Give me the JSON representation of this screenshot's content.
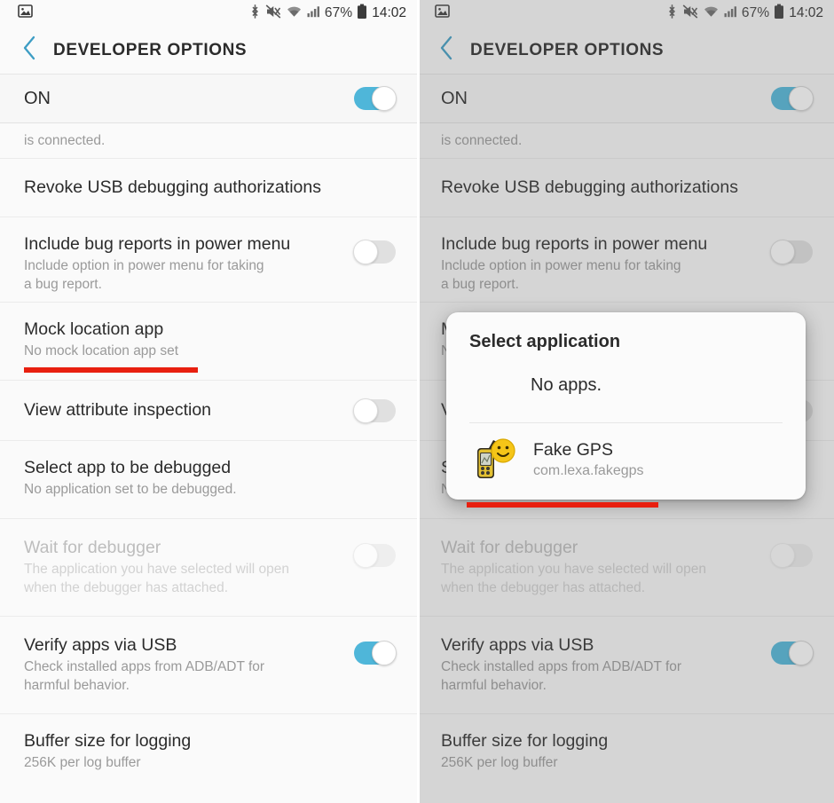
{
  "statusbar": {
    "left_icons": [
      "image-icon"
    ],
    "right_icons": [
      "bluetooth-icon",
      "mute-icon",
      "wifi-icon",
      "signal-icon"
    ],
    "battery_percent": "67%",
    "battery_icon": "battery-icon",
    "time": "14:02"
  },
  "header": {
    "back_icon": "chevron-left-icon",
    "title": "DEVELOPER OPTIONS"
  },
  "master_switch": {
    "label": "ON",
    "state": "on"
  },
  "rows": [
    {
      "title": "",
      "sub": "is connected.",
      "control": "none",
      "clipped": true,
      "dim": false
    },
    {
      "title": "Revoke USB debugging authorizations",
      "sub": "",
      "control": "none",
      "clipped": false,
      "dim": false
    },
    {
      "title": "Include bug reports in power menu",
      "sub": "Include option in power menu for taking\na bug report.",
      "control": "toggle-off",
      "clipped": false,
      "dim": false
    },
    {
      "title": "Mock location app",
      "sub": "No mock location app set",
      "control": "none",
      "clipped": false,
      "dim": false
    },
    {
      "title": "View attribute inspection",
      "sub": "",
      "control": "toggle-off",
      "clipped": false,
      "dim": false
    },
    {
      "title": "Select app to be debugged",
      "sub": "No application set to be debugged.",
      "control": "none",
      "clipped": false,
      "dim": false
    },
    {
      "title": "Wait for debugger",
      "sub": "The application you have selected will open\nwhen the debugger has attached.",
      "control": "toggle-off-faded",
      "clipped": false,
      "dim": true
    },
    {
      "title": "Verify apps via USB",
      "sub": "Check installed apps from ADB/ADT for\nharmful behavior.",
      "control": "toggle-on",
      "clipped": false,
      "dim": false
    },
    {
      "title": "Buffer size for logging",
      "sub": "256K per log buffer",
      "control": "none",
      "clipped": false,
      "dim": false
    }
  ],
  "dialog": {
    "title": "Select application",
    "no_apps_label": "No apps.",
    "app": {
      "icon": "fake-gps-app-icon",
      "name": "Fake GPS",
      "package": "com.lexa.fakegps"
    }
  },
  "annotations": {
    "left_underline_label": "red-underline-mock-location",
    "right_underline_label": "red-underline-package-name",
    "color": "#e81f0f"
  },
  "colors": {
    "accent_toggle_on": "#4fb6d9",
    "back_chevron": "#3d9dc4",
    "page_background": "#fafafa",
    "title_text": "#2b2b2b",
    "subtitle_text": "#9a9a9a",
    "scrim": "rgba(110,110,110,0.26)"
  }
}
